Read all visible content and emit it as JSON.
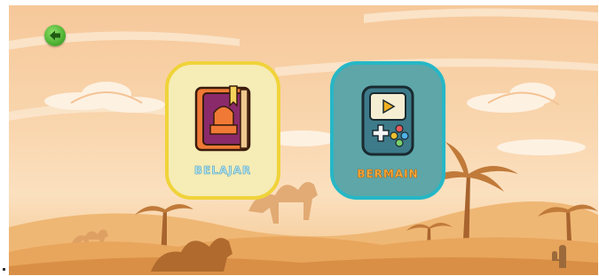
{
  "menu": {
    "back_icon": "back-arrow-icon",
    "learn_label": "BELAJAR",
    "learn_icon": "book-icon",
    "play_label": "BERMAIN",
    "play_icon": "game-console-icon"
  },
  "colors": {
    "sky": "#f9d6ae",
    "learn_card_bg": "#f5ecb6",
    "learn_card_border": "#f0d33a",
    "play_card_bg": "#5ea6a8",
    "play_card_border": "#26b7c6",
    "back_button": "#4fb233"
  }
}
